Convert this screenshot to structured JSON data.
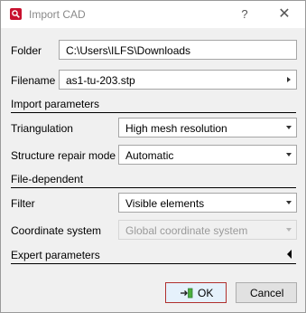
{
  "window": {
    "title": "Import CAD",
    "help": "?",
    "close": "✕"
  },
  "folder": {
    "label": "Folder",
    "value": "C:\\Users\\ILFS\\Downloads"
  },
  "filename": {
    "label": "Filename",
    "value": "as1-tu-203.stp"
  },
  "import_parameters": {
    "header": "Import parameters",
    "triangulation": {
      "label": "Triangulation",
      "value": "High mesh resolution"
    },
    "structure_repair": {
      "label": "Structure repair mode",
      "value": "Automatic"
    }
  },
  "file_dependent": {
    "header": "File-dependent",
    "filter": {
      "label": "Filter",
      "value": "Visible elements"
    },
    "coordinate_system": {
      "label": "Coordinate system",
      "value": "Global coordinate system",
      "enabled": false
    }
  },
  "expert": {
    "header": "Expert parameters",
    "expanded": false
  },
  "buttons": {
    "ok": "OK",
    "cancel": "Cancel"
  },
  "colors": {
    "accent": "#c8102e",
    "dialog_bg": "#f0f0f0",
    "default_button_border": "#b0302e"
  },
  "icons": {
    "app": "import-cad-icon",
    "ok": "import-arrow-icon"
  }
}
